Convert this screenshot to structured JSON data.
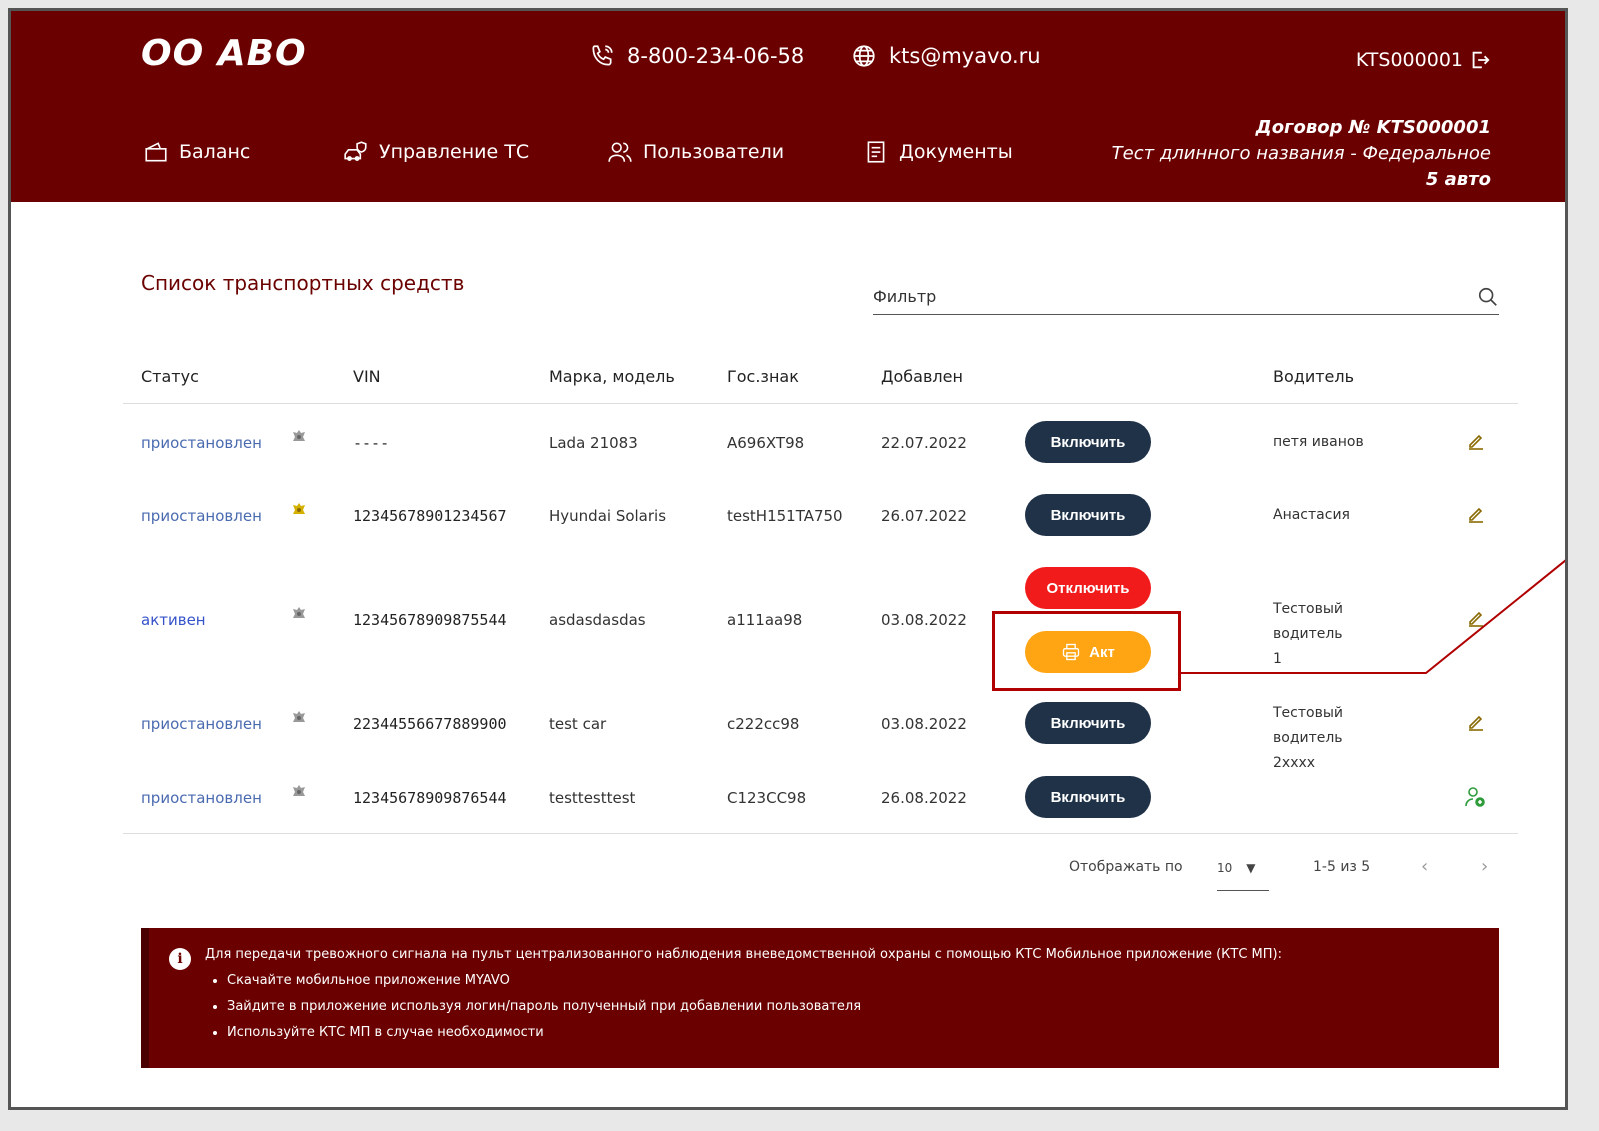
{
  "header": {
    "logo": "ОО АВО",
    "phone": "8-800-234-06-58",
    "email": "kts@myavo.ru",
    "account": "KTS000001",
    "nav": [
      "Баланс",
      "Управление ТС",
      "Пользователи",
      "Документы"
    ],
    "contract_number": "Договор № KTS000001",
    "contract_name": "Тест длинного названия - Федеральное",
    "vehicles_count": "5 авто"
  },
  "main": {
    "title": "Список транспортных средств",
    "filter_placeholder": "Фильтр",
    "columns": {
      "status": "Статус",
      "vin": "VIN",
      "model": "Марка, модель",
      "plate": "Гос.знак",
      "added": "Добавлен",
      "driver": "Водитель"
    },
    "rows": [
      {
        "status": "приостановлен",
        "vin": "----",
        "model": "Lada 21083",
        "plate": "A696XT98",
        "added": "22.07.2022",
        "action": "Включить",
        "driver": "петя иванов",
        "driver2": ""
      },
      {
        "status": "приостановлен",
        "vin": "12345678901234567",
        "model": "Hyundai Solaris",
        "plate": "testH151TA750",
        "added": "26.07.2022",
        "action": "Включить",
        "driver": "Анастасия",
        "driver2": ""
      },
      {
        "status": "активен",
        "vin": "12345678909875544",
        "model": "asdasdasdas",
        "plate": "a111aa98",
        "added": "03.08.2022",
        "action": "Отключить",
        "action2": "Акт",
        "driver": "Тестовый водитель",
        "driver2": "1"
      },
      {
        "status": "приостановлен",
        "vin": "22344556677889900",
        "model": "test car",
        "plate": "c222cc98",
        "added": "03.08.2022",
        "action": "Включить",
        "driver": "Тестовый водитель",
        "driver2": "2xxxx"
      },
      {
        "status": "приостановлен",
        "vin": "12345678909876544",
        "model": "testtesttest",
        "plate": "C123CC98",
        "added": "26.08.2022",
        "action": "Включить",
        "driver": "",
        "driver2": ""
      }
    ],
    "pager": {
      "per_page_label": "Отображать по",
      "per_page_value": "10",
      "range": "1-5 из 5"
    }
  },
  "notice": {
    "intro": "Для передачи тревожного сигнала на пульт централизованного наблюдения вневедомственной охраны с помощью КТС Мобильное приложение (КТС МП):",
    "items": [
      "Скачайте мобильное приложение MYAVO",
      "Зайдите в приложение используя логин/пароль полученный при добавлении пользователя",
      "Используйте КТС МП в случае необходимости"
    ]
  },
  "colors": {
    "brand": "#6b0000",
    "button_dark": "#1f3247",
    "button_red": "#f21b1b",
    "button_orange": "#ffa412"
  }
}
